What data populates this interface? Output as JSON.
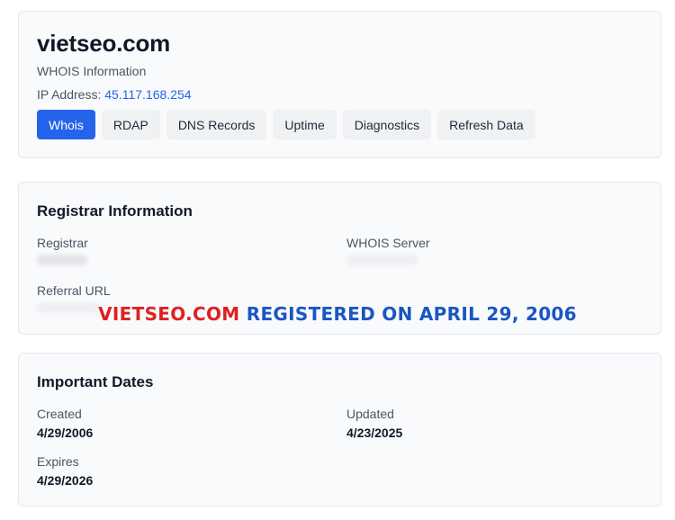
{
  "header": {
    "domain": "vietseo.com",
    "subtitle": "WHOIS Information",
    "ip_label": "IP Address:",
    "ip_value": "45.117.168.254",
    "tabs": [
      {
        "label": "Whois",
        "active": true
      },
      {
        "label": "RDAP",
        "active": false
      },
      {
        "label": "DNS Records",
        "active": false
      },
      {
        "label": "Uptime",
        "active": false
      },
      {
        "label": "Diagnostics",
        "active": false
      },
      {
        "label": "Refresh Data",
        "active": false
      }
    ]
  },
  "registrar": {
    "title": "Registrar Information",
    "registrar_label": "Registrar",
    "whois_server_label": "WHOIS Server",
    "referral_url_label": "Referral URL"
  },
  "overlay": {
    "domain": "VIETSEO.COM",
    "text": " REGISTERED ON APRIL 29, 2006"
  },
  "dates": {
    "title": "Important Dates",
    "created_label": "Created",
    "created_value": "4/29/2006",
    "updated_label": "Updated",
    "updated_value": "4/23/2025",
    "expires_label": "Expires",
    "expires_value": "4/29/2026"
  },
  "colors": {
    "accent": "#2563eb",
    "overlay_red": "#e02020",
    "overlay_blue": "#1a56c4"
  }
}
